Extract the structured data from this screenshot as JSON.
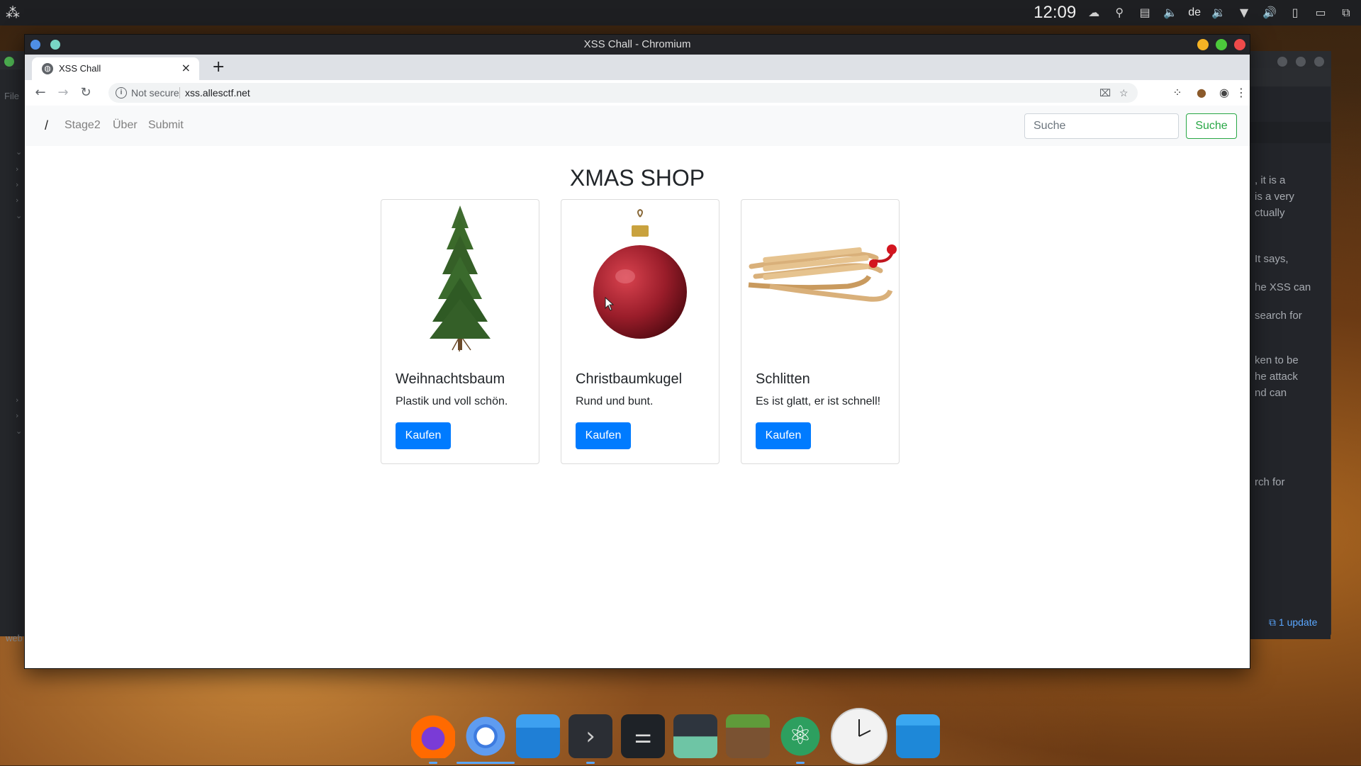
{
  "system": {
    "clock": "12:09",
    "language": "de"
  },
  "background_window": {
    "file_menu": "File",
    "bottom_left": "web",
    "update_badge": "1 update",
    "text_snippets": [
      ", it is a",
      " is a very",
      "ctually",
      " It says,",
      "he XSS can",
      " search for",
      "ken to be",
      "he attack",
      "nd can",
      "rch for"
    ]
  },
  "browser": {
    "window_title": "XSS Chall - Chromium",
    "tab_label": "XSS Chall",
    "new_tab": "+",
    "security_label": "Not secure",
    "url": "xss.allesctf.net"
  },
  "page": {
    "navbar": {
      "brand": "/",
      "links": [
        "Stage2",
        "Über",
        "Submit"
      ],
      "search_placeholder": "Suche",
      "search_button": "Suche"
    },
    "title": "XMAS SHOP",
    "products": [
      {
        "name": "Weihnachtsbaum",
        "description": "Plastik und voll schön.",
        "button": "Kaufen"
      },
      {
        "name": "Christbaumkugel",
        "description": "Rund und bunt.",
        "button": "Kaufen"
      },
      {
        "name": "Schlitten",
        "description": "Es ist glatt, er ist schnell!",
        "button": "Kaufen"
      }
    ]
  },
  "colors": {
    "primary_button": "#007bff",
    "search_button": "#28a745"
  }
}
